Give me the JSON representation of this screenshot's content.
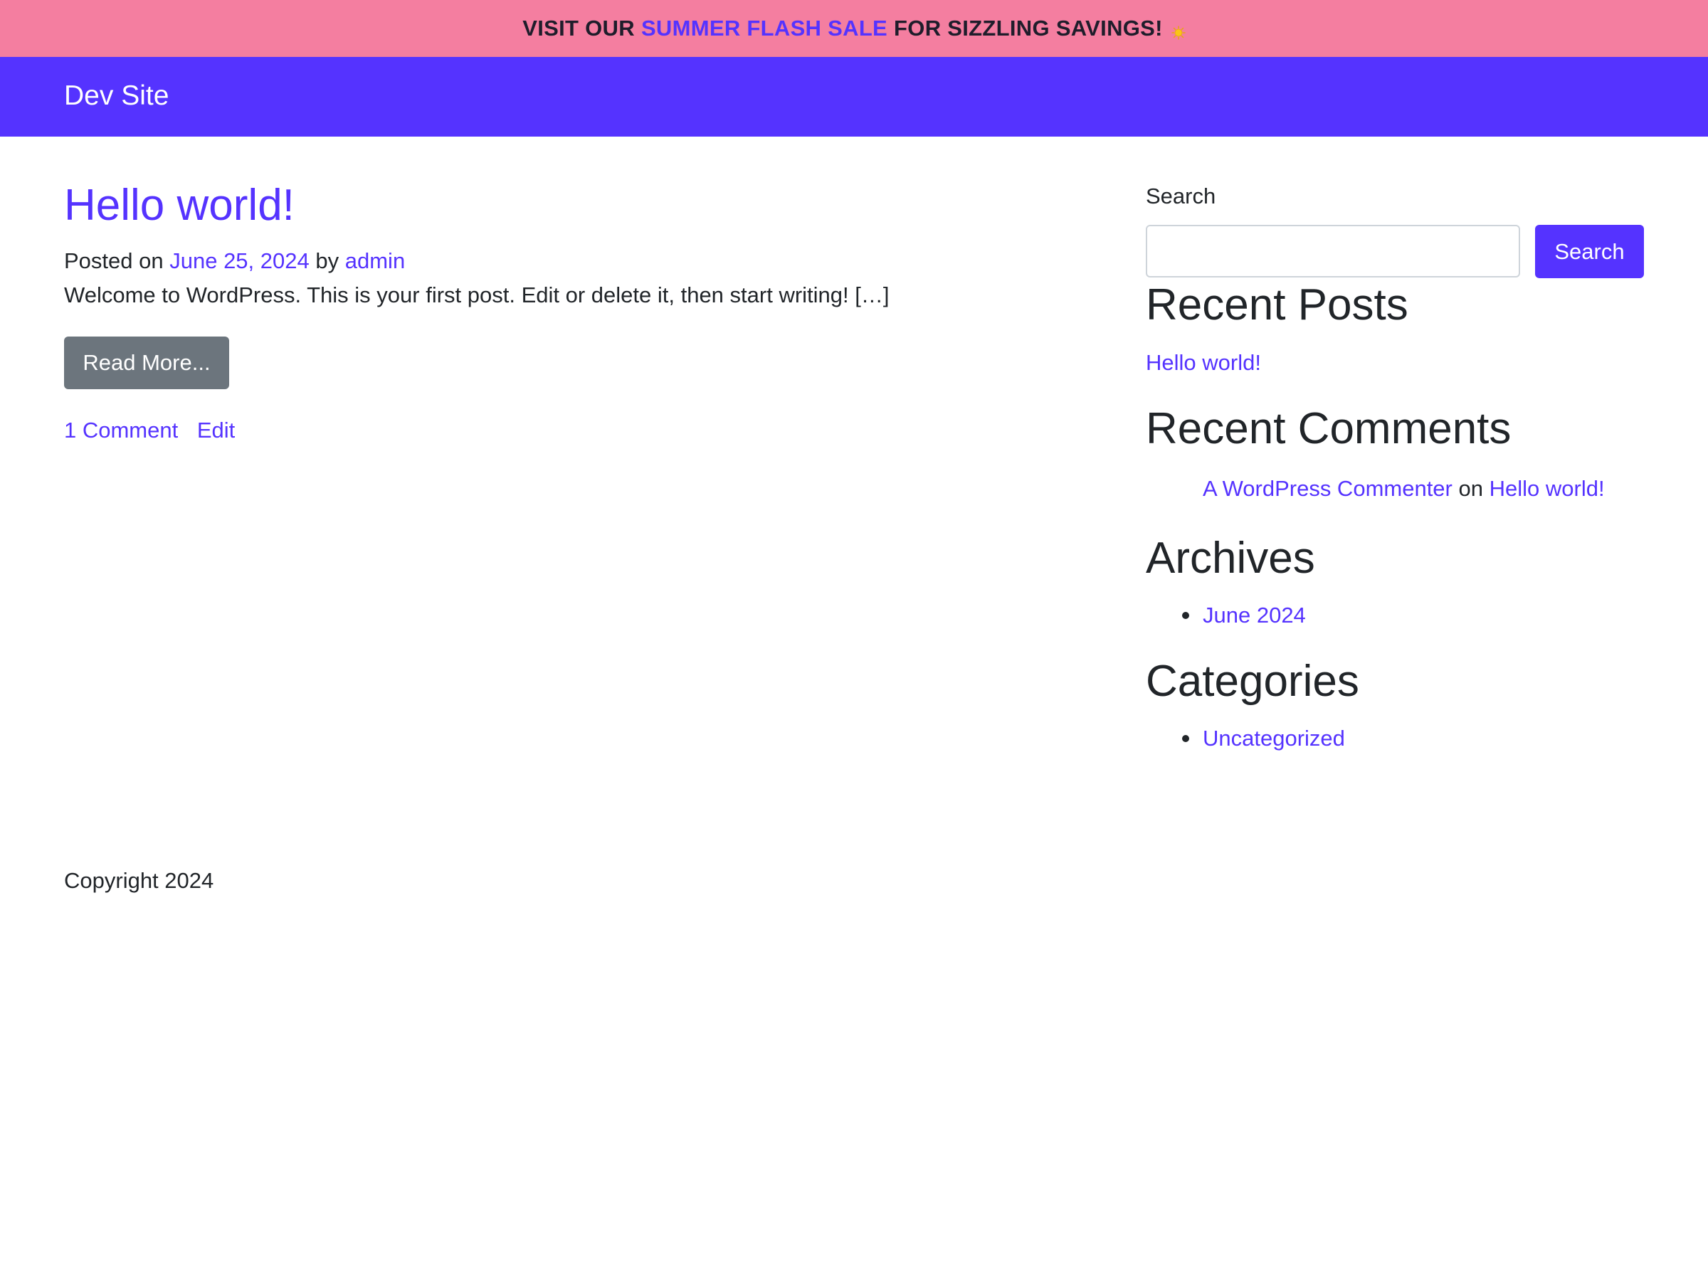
{
  "promo_banner": {
    "text_before": "VISIT OUR",
    "link_text": "SUMMER FLASH SALE",
    "text_after": "FOR SIZZLING SAVINGS!",
    "icon": "sun-icon"
  },
  "navbar": {
    "brand": "Dev Site"
  },
  "post": {
    "title": "Hello world!",
    "meta_prefix": "Posted on",
    "date": "June 25, 2024",
    "meta_by": "by",
    "author": "admin",
    "excerpt": "Welcome to WordPress. This is your first post. Edit or delete it, then start writing! […]",
    "read_more_label": "Read More...",
    "comments_link": "1 Comment",
    "edit_link": "Edit"
  },
  "sidebar": {
    "search_label": "Search",
    "search_placeholder": "",
    "search_button": "Search",
    "recent_posts": {
      "heading": "Recent Posts",
      "items": [
        "Hello world!"
      ]
    },
    "recent_comments": {
      "heading": "Recent Comments",
      "items": [
        {
          "author": "A WordPress Commenter",
          "connector": "on",
          "post": "Hello world!"
        }
      ]
    },
    "archives": {
      "heading": "Archives",
      "items": [
        "June 2024"
      ]
    },
    "categories": {
      "heading": "Categories",
      "items": [
        "Uncategorized"
      ]
    }
  },
  "footer": {
    "copyright": "Copyright 2024"
  },
  "colors": {
    "accent": "#5533ff",
    "banner_background": "#f47ea0",
    "button_secondary": "#6c757d",
    "text": "#212529"
  }
}
